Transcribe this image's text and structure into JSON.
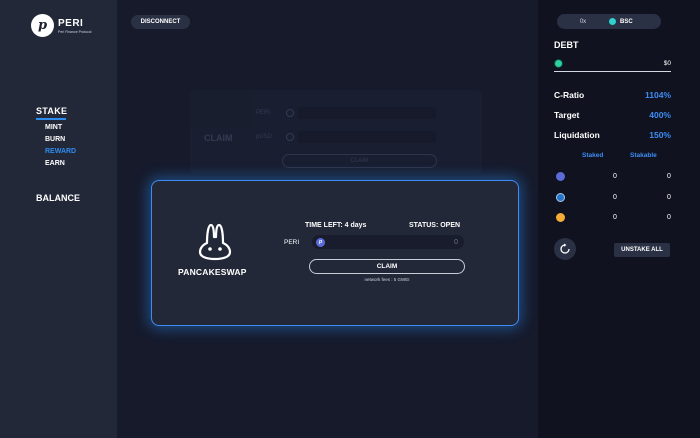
{
  "brand": {
    "name": "PERI",
    "tagline": "Peri Finance Protocol",
    "logo_letter": "p"
  },
  "nav": {
    "stake": "STAKE",
    "sub": [
      "MINT",
      "BURN",
      "REWARD",
      "EARN"
    ],
    "active_sub": "REWARD",
    "balance": "BALANCE"
  },
  "header": {
    "disconnect": "DISCONNECT"
  },
  "background_panel": {
    "title": "CLAIM",
    "rows": [
      {
        "label": "PERI"
      },
      {
        "label": "pUSD"
      }
    ],
    "button": "CLAIM"
  },
  "modal": {
    "brand": "PANCAKESWAP",
    "time_left": "TIME LEFT: 4 days",
    "status": "STATUS: OPEN",
    "token_label": "PERI",
    "token_value": "0",
    "claim_button": "CLAIM",
    "fees": "network fees : 5 GWEI"
  },
  "right": {
    "address": "0x",
    "network": "BSC",
    "debt_title": "DEBT",
    "debt_value": "$0",
    "stats": [
      {
        "label": "C-Ratio",
        "value": "1104%"
      },
      {
        "label": "Target",
        "value": "400%"
      },
      {
        "label": "Liquidation",
        "value": "150%"
      }
    ],
    "table_headers": {
      "staked": "Staked",
      "stakable": "Stakable"
    },
    "table_rows": [
      {
        "icon": "peri-coin-icon",
        "staked": "0",
        "stakable": "0"
      },
      {
        "icon": "usdc-coin-icon",
        "staked": "0",
        "stakable": "0"
      },
      {
        "icon": "dai-coin-icon",
        "staked": "0",
        "stakable": "0"
      }
    ],
    "unstake_all": "UNSTAKE ALL"
  },
  "colors": {
    "accent": "#3d8cf5",
    "bg": "#161a2b",
    "panel": "#232839",
    "network_dot": "#2fd0d0"
  }
}
